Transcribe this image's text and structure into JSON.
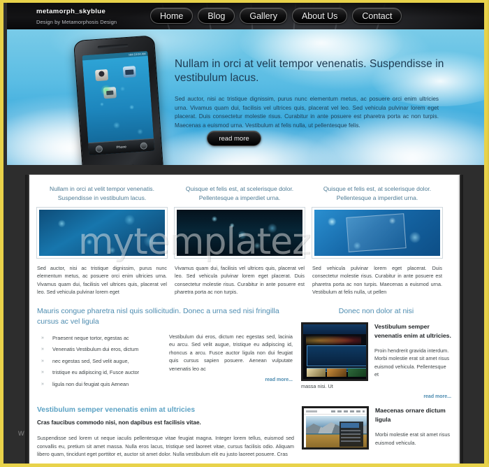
{
  "header": {
    "logo_title": "metamorph_skyblue",
    "logo_sub": "Design by Metamorphosis Design",
    "nav": [
      {
        "label": "Home"
      },
      {
        "label": "Blog"
      },
      {
        "label": "Gallery"
      },
      {
        "label": "About Us"
      },
      {
        "label": "Contact"
      }
    ]
  },
  "hero": {
    "heading": "Nullam in orci at velit tempor venenatis. Suspendisse in vestibulum lacus.",
    "paragraph": "Sed auctor, nisi ac tristique dignissim, purus nunc elementum metus, ac posuere orci enim ultricies urna. Vivamus quam dui, facilisis vel ultrices quis, placerat vel leo. Sed vehicula pulvinar lorem eget placerat. Duis consectetur molestie risus. Curabitur in ante posuere est pharetra porta ac non turpis. Maecenas a euismod urna. Vestibulum at felis nulla, ut pellentesque felis.",
    "read_more": "read more",
    "phone": {
      "status_text": "HM 10:04 AM",
      "dock_label": "Phone"
    }
  },
  "columns": [
    {
      "heading": "Nullam in orci at velit tempor venenatis. Suspendisse in vestibulum lacus.",
      "body": "Sed auctor, nisi ac tristique dignissim, purus nunc elementum metus, ac posuere orci enim ultricies urna. Vivamus quam dui, facilisis vel ultrices quis, placerat vel leo. Sed vehicula pulvinar lorem eget"
    },
    {
      "heading": "Quisque et felis est, at scelerisque dolor. Pellentesque a imperdiet urna.",
      "body": "Vivamus quam dui, facilisis vel ultrices quis, placerat vel leo. Sed vehicula pulvinar lorem eget placerat. Duis consectetur molestie risus. Curabitur in ante posuere est pharetra porta ac non turpis."
    },
    {
      "heading": "Quisque et felis est, at scelerisque dolor. Pellentesque a imperdiet urna.",
      "body": "Sed vehicula pulvinar lorem eget placerat. Duis consectetur molestie risus. Curabitur in ante posuere est pharetra porta ac non turpis. Maecenas a euismod urna. Vestibulum at felis nulla, ut pellen"
    }
  ],
  "section2": {
    "left_heading": "Mauris congue pharetra nisl quis sollicitudin. Donec a urna sed nisi fringilla cursus ac vel ligula",
    "bullets": [
      "Praesent neque tortor, egestas ac",
      "Venenatis Vestibulum dui eros, dictum",
      "nec egestas sed, Sed velit augue,",
      "tristique eu adipiscing id, Fusce auctor",
      "ligula non dui feugiat quis Aenean"
    ],
    "right_paragraph": "Vestibulum dui eros, dictum nec egestas sed, lacinia eu arcu. Sed velit augue, tristique eu adipiscing id, rhoncus a arcu. Fusce auctor ligula non dui feugiat quis cursus sapien posuere. Aenean vulputate venenatis leo ac",
    "read_more": "read more...",
    "sidebar": {
      "heading": "Donec non dolor at nisi",
      "item_heading": "Vestibulum semper venenatis enim at ultricies.",
      "item_paragraph": "Proin hendrerit gravida interdum. Morbi molestie erat sit amet risus euismod vehicula. Pellentesque et",
      "item_overflow": "massa nisi. Ut",
      "read_more": "read more..."
    }
  },
  "section3": {
    "heading": "Vestibulum semper venenatis enim at ultricies",
    "subheading": "Cras faucibus commodo nisi, non dapibus est facilisis vitae.",
    "paragraph": "Suspendisse sed lorem ut neque iaculis pellentesque vitae feugiat magna. Integer lorem tellus, euismod sed convallis eu, pretium sit amet massa. Nulla eros lacus, tristique sed laoreet vitae, cursus facilisis odio. Aliquam libero quam, tincidunt eget porttitor et, auctor sit amet dolor. Nulla vestibulum elit eu justo laoreet posuere. Cras",
    "sidebar": {
      "item_heading": "Maecenas ornare dictum ligula",
      "item_paragraph": "Morbi molestie erat sit amet risus euismod vehicula."
    }
  },
  "watermarks": {
    "main": "mytemplatez",
    "left": "w"
  },
  "colors": {
    "rim_yellow": "#e8d24a",
    "frame_dark": "#2d2d2d",
    "sky_blue": "#3aa9dc",
    "link_blue": "#4d8cb0",
    "heading_blue": "#5ba2c4",
    "body_text": "#3e4446"
  }
}
